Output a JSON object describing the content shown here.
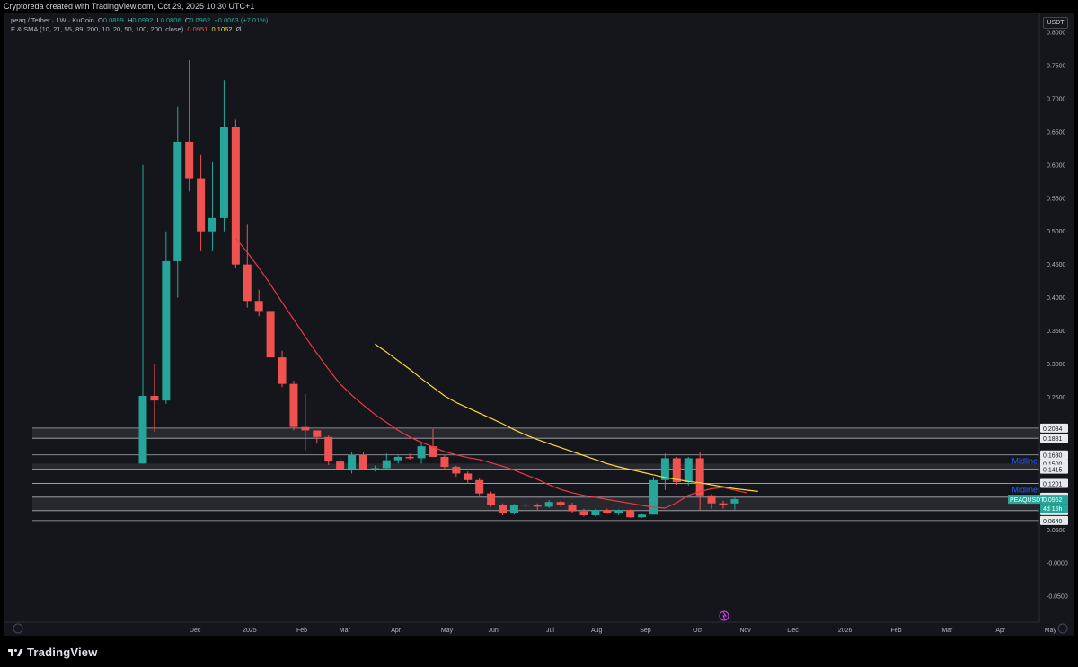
{
  "header": {
    "attribution": "Cryptoreda created with TradingView.com, Oct 29, 2025 10:30 UTC+1"
  },
  "legend": {
    "symbol_line": "peaq / Tether · 1W · KuCoin",
    "open_label": "O",
    "open": "0.0899",
    "high_label": "H",
    "high": "0.0992",
    "low_label": "L",
    "low": "0.0806",
    "close_label": "C",
    "close": "0.0962",
    "change": "+0.0063 (+7.01%)",
    "indicator_line": "E & SMA (10, 21, 55, 89, 200, 10, 20, 50, 100, 200, close)",
    "ema_value": "0.0951",
    "sma_value": "0.1062",
    "extra": "Ø"
  },
  "currency_button": "USDT",
  "logo_text": "TradingView",
  "colors": {
    "up": "#26a69a",
    "down": "#ef5350",
    "ema": "#f23645",
    "sma": "#fdd835",
    "zone": "#2a2b31",
    "background": "#15161b",
    "midline_text": "#2962ff"
  },
  "chart_data": {
    "type": "candlestick",
    "symbol": "PEAQUSDT",
    "interval": "1W",
    "ylim": [
      -0.08,
      0.8
    ],
    "y_ticks": [
      "0.8000",
      "0.7500",
      "0.7000",
      "0.6500",
      "0.6000",
      "0.5500",
      "0.5000",
      "0.4500",
      "0.4000",
      "0.3500",
      "0.3000",
      "0.2500",
      "0.0500",
      "-0.0000",
      "-0.0500"
    ],
    "x_labels": [
      {
        "label": "Dec",
        "at": 4.5
      },
      {
        "label": "2025",
        "at": 9.2
      },
      {
        "label": "Feb",
        "at": 13.7
      },
      {
        "label": "Mar",
        "at": 17.4
      },
      {
        "label": "Apr",
        "at": 21.8
      },
      {
        "label": "May",
        "at": 26.2
      },
      {
        "label": "Jun",
        "at": 30.2
      },
      {
        "label": "Jul",
        "at": 35.1
      },
      {
        "label": "Aug",
        "at": 39.1
      },
      {
        "label": "Sep",
        "at": 43.3
      },
      {
        "label": "Oct",
        "at": 47.8
      },
      {
        "label": "Nov",
        "at": 51.9
      },
      {
        "label": "Dec",
        "at": 56.0
      },
      {
        "label": "2026",
        "at": 60.5
      },
      {
        "label": "Feb",
        "at": 64.9
      },
      {
        "label": "Mar",
        "at": 69.3
      },
      {
        "label": "Apr",
        "at": 73.9
      },
      {
        "label": "May",
        "at": 78.2
      }
    ],
    "candles": [
      {
        "o": 0.15,
        "h": 0.6,
        "l": 0.15,
        "c": 0.252
      },
      {
        "o": 0.252,
        "h": 0.3,
        "l": 0.198,
        "c": 0.245
      },
      {
        "o": 0.245,
        "h": 0.5,
        "l": 0.24,
        "c": 0.455
      },
      {
        "o": 0.455,
        "h": 0.688,
        "l": 0.4,
        "c": 0.635
      },
      {
        "o": 0.635,
        "h": 0.758,
        "l": 0.56,
        "c": 0.58
      },
      {
        "o": 0.58,
        "h": 0.615,
        "l": 0.47,
        "c": 0.5
      },
      {
        "o": 0.5,
        "h": 0.605,
        "l": 0.47,
        "c": 0.52
      },
      {
        "o": 0.52,
        "h": 0.728,
        "l": 0.5,
        "c": 0.657
      },
      {
        "o": 0.657,
        "h": 0.668,
        "l": 0.445,
        "c": 0.45
      },
      {
        "o": 0.45,
        "h": 0.51,
        "l": 0.385,
        "c": 0.395
      },
      {
        "o": 0.395,
        "h": 0.412,
        "l": 0.372,
        "c": 0.38
      },
      {
        "o": 0.38,
        "h": 0.38,
        "l": 0.31,
        "c": 0.31
      },
      {
        "o": 0.31,
        "h": 0.32,
        "l": 0.265,
        "c": 0.27
      },
      {
        "o": 0.27,
        "h": 0.275,
        "l": 0.2,
        "c": 0.205
      },
      {
        "o": 0.205,
        "h": 0.255,
        "l": 0.17,
        "c": 0.2
      },
      {
        "o": 0.2,
        "h": 0.2,
        "l": 0.18,
        "c": 0.19
      },
      {
        "o": 0.19,
        "h": 0.192,
        "l": 0.148,
        "c": 0.153
      },
      {
        "o": 0.153,
        "h": 0.16,
        "l": 0.14,
        "c": 0.142
      },
      {
        "o": 0.142,
        "h": 0.168,
        "l": 0.135,
        "c": 0.163
      },
      {
        "o": 0.163,
        "h": 0.168,
        "l": 0.14,
        "c": 0.142
      },
      {
        "o": 0.142,
        "h": 0.147,
        "l": 0.138,
        "c": 0.143
      },
      {
        "o": 0.143,
        "h": 0.165,
        "l": 0.142,
        "c": 0.155
      },
      {
        "o": 0.155,
        "h": 0.162,
        "l": 0.15,
        "c": 0.16
      },
      {
        "o": 0.16,
        "h": 0.165,
        "l": 0.156,
        "c": 0.158
      },
      {
        "o": 0.158,
        "h": 0.182,
        "l": 0.15,
        "c": 0.176
      },
      {
        "o": 0.176,
        "h": 0.202,
        "l": 0.16,
        "c": 0.16
      },
      {
        "o": 0.16,
        "h": 0.163,
        "l": 0.14,
        "c": 0.145
      },
      {
        "o": 0.145,
        "h": 0.147,
        "l": 0.13,
        "c": 0.135
      },
      {
        "o": 0.135,
        "h": 0.138,
        "l": 0.12,
        "c": 0.125
      },
      {
        "o": 0.125,
        "h": 0.128,
        "l": 0.102,
        "c": 0.105
      },
      {
        "o": 0.105,
        "h": 0.108,
        "l": 0.085,
        "c": 0.088
      },
      {
        "o": 0.088,
        "h": 0.09,
        "l": 0.072,
        "c": 0.075
      },
      {
        "o": 0.075,
        "h": 0.089,
        "l": 0.073,
        "c": 0.088
      },
      {
        "o": 0.088,
        "h": 0.09,
        "l": 0.083,
        "c": 0.087
      },
      {
        "o": 0.087,
        "h": 0.09,
        "l": 0.08,
        "c": 0.085
      },
      {
        "o": 0.085,
        "h": 0.095,
        "l": 0.083,
        "c": 0.092
      },
      {
        "o": 0.092,
        "h": 0.094,
        "l": 0.085,
        "c": 0.088
      },
      {
        "o": 0.088,
        "h": 0.091,
        "l": 0.076,
        "c": 0.078
      },
      {
        "o": 0.078,
        "h": 0.082,
        "l": 0.07,
        "c": 0.072
      },
      {
        "o": 0.072,
        "h": 0.082,
        "l": 0.07,
        "c": 0.08
      },
      {
        "o": 0.08,
        "h": 0.082,
        "l": 0.074,
        "c": 0.075
      },
      {
        "o": 0.075,
        "h": 0.081,
        "l": 0.072,
        "c": 0.08
      },
      {
        "o": 0.08,
        "h": 0.081,
        "l": 0.068,
        "c": 0.069
      },
      {
        "o": 0.069,
        "h": 0.074,
        "l": 0.068,
        "c": 0.073
      },
      {
        "o": 0.073,
        "h": 0.13,
        "l": 0.073,
        "c": 0.125
      },
      {
        "o": 0.125,
        "h": 0.165,
        "l": 0.11,
        "c": 0.158
      },
      {
        "o": 0.158,
        "h": 0.16,
        "l": 0.118,
        "c": 0.122
      },
      {
        "o": 0.122,
        "h": 0.16,
        "l": 0.117,
        "c": 0.158
      },
      {
        "o": 0.158,
        "h": 0.168,
        "l": 0.08,
        "c": 0.102
      },
      {
        "o": 0.102,
        "h": 0.104,
        "l": 0.082,
        "c": 0.09
      },
      {
        "o": 0.09,
        "h": 0.094,
        "l": 0.082,
        "c": 0.088
      },
      {
        "o": 0.0899,
        "h": 0.0992,
        "l": 0.0806,
        "c": 0.0962
      }
    ],
    "ema": {
      "color": "#f23645",
      "start": 8,
      "values": [
        0.49,
        0.468,
        0.445,
        0.42,
        0.393,
        0.367,
        0.341,
        0.316,
        0.292,
        0.27,
        0.253,
        0.238,
        0.224,
        0.212,
        0.2,
        0.19,
        0.182,
        0.175,
        0.168,
        0.163,
        0.159,
        0.156,
        0.151,
        0.146,
        0.14,
        0.133,
        0.126,
        0.118,
        0.111,
        0.106,
        0.102,
        0.099,
        0.096,
        0.093,
        0.09,
        0.087,
        0.084,
        0.083,
        0.091,
        0.102,
        0.108,
        0.112,
        0.114,
        0.11,
        0.106
      ]
    },
    "sma": {
      "color": "#fdd835",
      "start": 20,
      "values": [
        0.33,
        0.318,
        0.305,
        0.292,
        0.278,
        0.265,
        0.252,
        0.242,
        0.234,
        0.226,
        0.218,
        0.21,
        0.201,
        0.193,
        0.186,
        0.18,
        0.174,
        0.168,
        0.162,
        0.156,
        0.15,
        0.145,
        0.141,
        0.137,
        0.133,
        0.129,
        0.126,
        0.123,
        0.121,
        0.118,
        0.115,
        0.112,
        0.11,
        0.108
      ]
    },
    "zones": [
      {
        "top": 0.2034,
        "bottom": 0.1881
      },
      {
        "top": 0.15,
        "bottom": 0.1415
      },
      {
        "top": 0.0993,
        "bottom": 0.079
      }
    ],
    "hlines": [
      0.2034,
      0.1881,
      0.163,
      0.1415,
      0.1201,
      0.0993,
      0.079,
      0.064
    ],
    "price_labels": [
      "0.2034",
      "0.1881",
      "0.1630",
      "0.1500",
      "0.1415",
      "0.1201",
      "0.0993",
      "0.0962",
      "0.0790",
      "0.0640"
    ],
    "annotations": [
      {
        "text": "Midline",
        "level": 0.163
      },
      {
        "text": "Midline",
        "level": 0.1201
      }
    ],
    "last_price_tag": {
      "symbol": "PEAQUSDT",
      "value": "0.0962",
      "countdown": "4d 15h"
    }
  }
}
